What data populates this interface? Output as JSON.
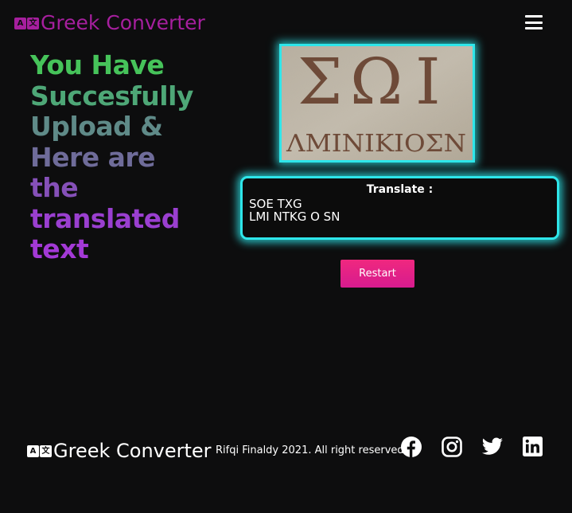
{
  "header": {
    "logo_glyphs": [
      "A",
      "文"
    ],
    "title": "Greek Converter",
    "menu_icon": "hamburger-menu-icon"
  },
  "hero": {
    "lines": [
      "You Have",
      "Succesfully",
      "Upload &",
      "Here are",
      "the",
      "translated",
      "text"
    ]
  },
  "uploaded_image": {
    "description_icon": "greek-inscription-photo",
    "glyphs_top": [
      "Σ",
      "Ω",
      "Ι"
    ],
    "glyphs_bottom": "ΛΜΙΝΙΚΙΟΣΝ"
  },
  "translation": {
    "label": "Translate :",
    "result": "SOE TXG\nLMI NTKG O SN"
  },
  "actions": {
    "restart_label": "Restart"
  },
  "footer": {
    "logo_glyphs": [
      "A",
      "文"
    ],
    "title": "Greek Converter",
    "copyright": "Rifqi Finaldy 2021. All right reserved",
    "social": [
      "facebook-icon",
      "instagram-icon",
      "twitter-icon",
      "linkedin-icon"
    ]
  },
  "colors": {
    "background": "#0d0d0e",
    "brand_purple": "#a61f9e",
    "accent_cyan": "#2ee6ea",
    "button_pink": "#e8208a",
    "hero_gradient": [
      "#46c35a",
      "#4ea777",
      "#5f8a88",
      "#6f6c9a",
      "#8550b8",
      "#9a3fd0",
      "#a339d6"
    ]
  }
}
